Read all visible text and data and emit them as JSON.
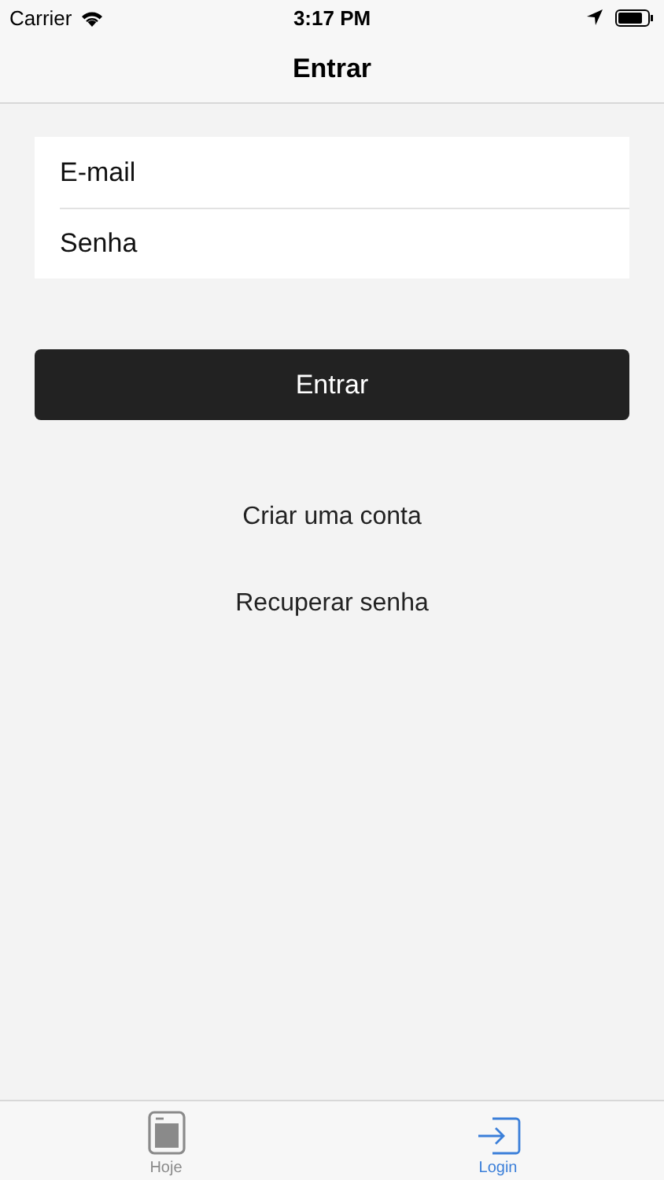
{
  "status_bar": {
    "carrier": "Carrier",
    "time": "3:17 PM"
  },
  "nav_bar": {
    "title": "Entrar"
  },
  "form": {
    "fields": [
      {
        "placeholder": "E-mail"
      },
      {
        "placeholder": "Senha"
      }
    ],
    "submit": "Entrar"
  },
  "links": [
    "Criar uma conta",
    "Recuperar senha"
  ],
  "tab_bar": [
    {
      "kind": "today",
      "label": "Hoje",
      "selected": false
    },
    {
      "kind": "login",
      "label": "Login",
      "selected": true
    }
  ]
}
